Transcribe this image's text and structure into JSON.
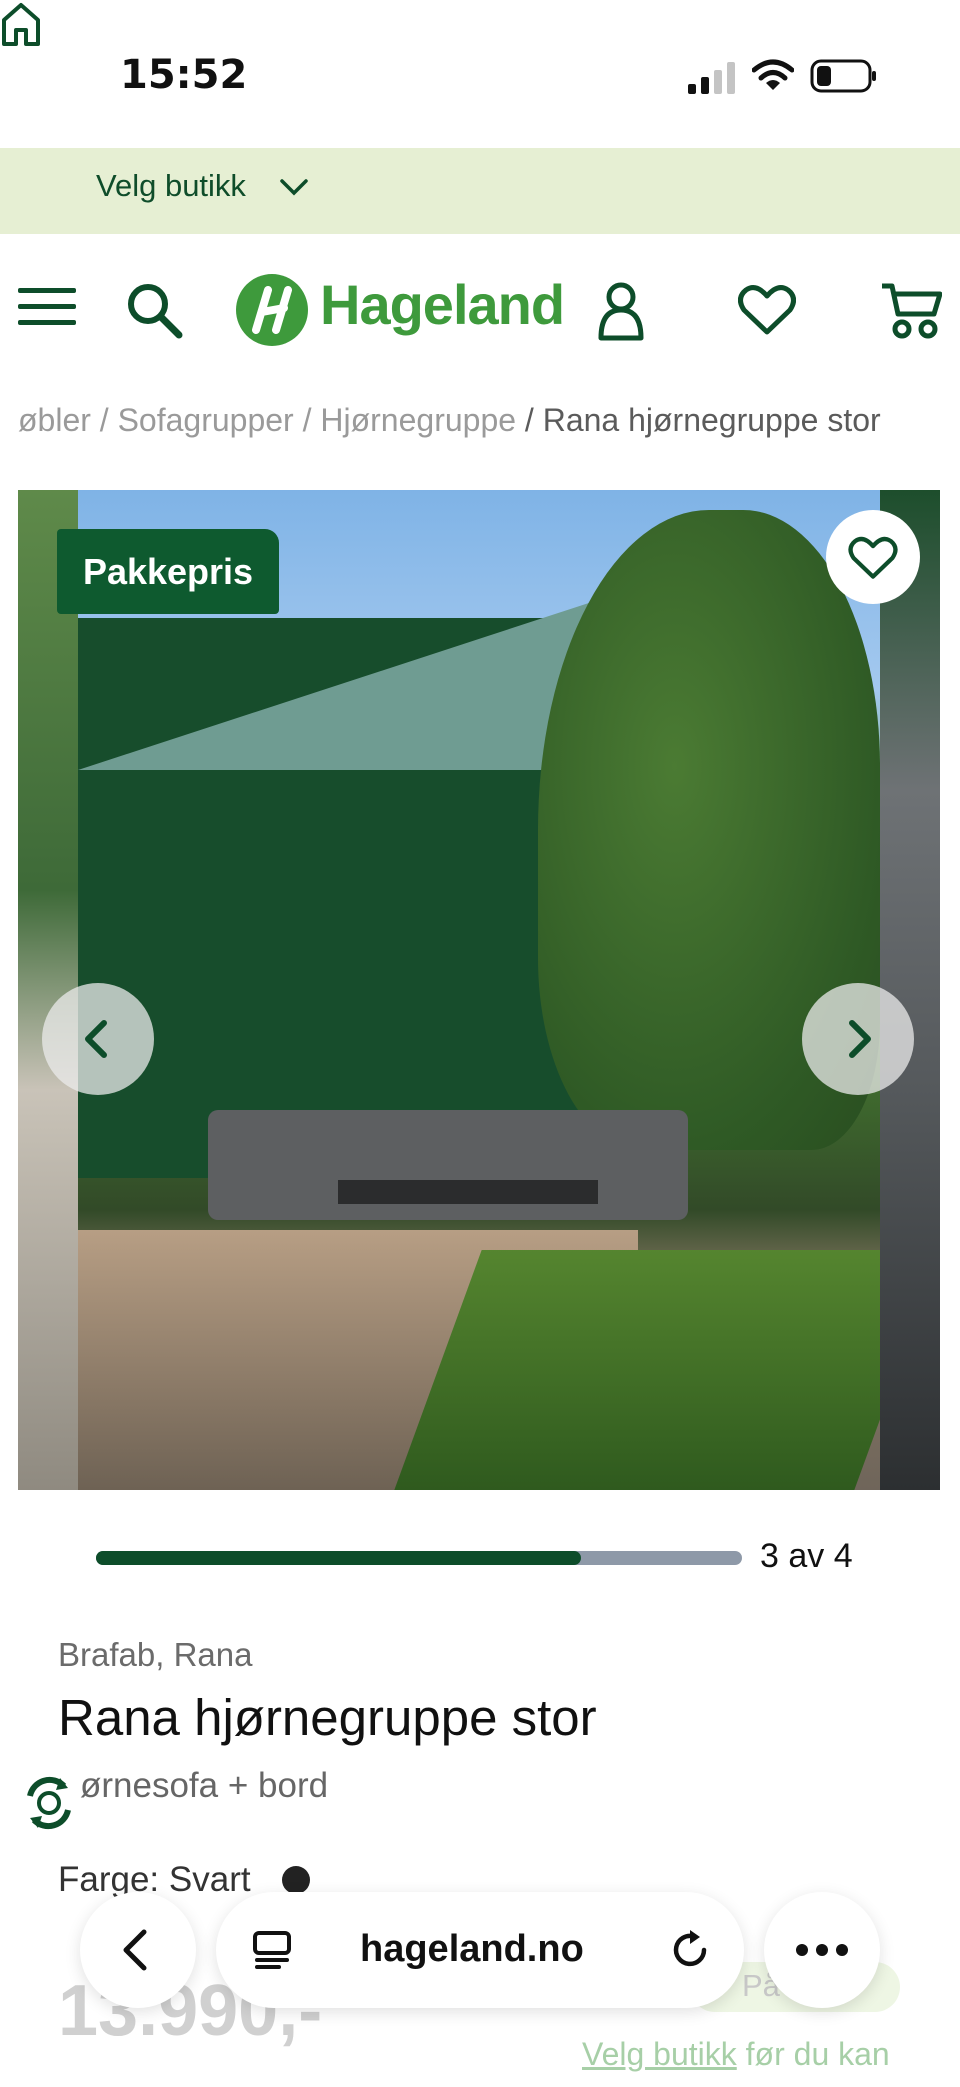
{
  "status_bar": {
    "time": "15:52",
    "battery_level": 0.3
  },
  "store_bar": {
    "label": "Velg butikk"
  },
  "header": {
    "logo_text": "Hageland"
  },
  "breadcrumb": {
    "items": [
      "øbler",
      "Sofagrupper",
      "Hjørnegruppe"
    ],
    "separator": "/",
    "current": "Rana hjørnegruppe stor"
  },
  "gallery": {
    "badge": "Pakkepris",
    "progress": {
      "text": "3 av 4",
      "current": 3,
      "total": 4,
      "fill_fraction": 0.75
    }
  },
  "product": {
    "brand": "Brafab, Rana",
    "title": "Rana hjørnegruppe stor",
    "subtitle": "ørnesofa + bord",
    "color_label": "Farge: Svart",
    "price": "13.990,-",
    "availability_partial": "På",
    "store_note_link": "Velg butikk",
    "store_note_rest": "før du kan"
  },
  "browser_bar": {
    "url": "hageland.no"
  },
  "colors": {
    "brand_green": "#0e5a2f",
    "store_bar_bg": "#e6efd3",
    "progress_track": "#8e99a8"
  }
}
